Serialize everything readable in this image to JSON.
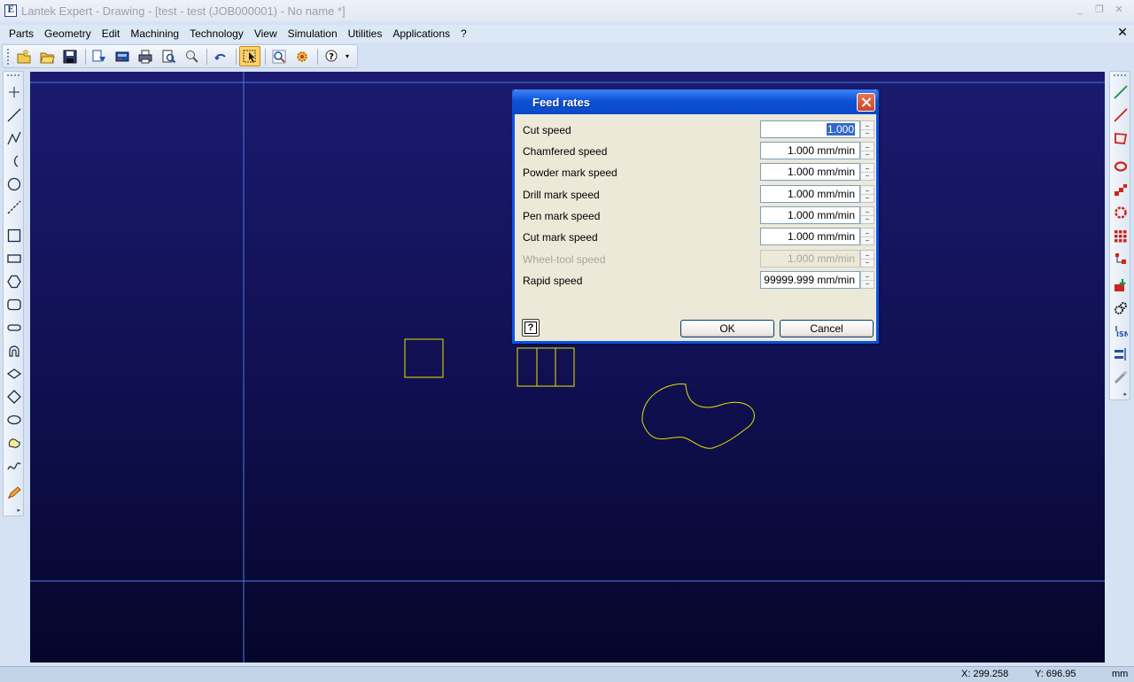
{
  "window": {
    "title": "Lantek Expert  - Drawing - [test - test (JOB000001) - No name *]",
    "icon_letter": "E",
    "minimize_glyph": "_",
    "restore_glyph": "❐",
    "close_glyph": "✕"
  },
  "menubar": {
    "items": [
      "Parts",
      "Geometry",
      "Edit",
      "Machining",
      "Technology",
      "View",
      "Simulation",
      "Utilities",
      "Applications",
      "?"
    ],
    "mdi_close_glyph": "✕"
  },
  "toolbar": {
    "icons": [
      "new-part-icon",
      "open-folder-icon",
      "save-icon",
      "export-icon",
      "machine-icon",
      "print-icon",
      "print-preview-icon",
      "zoom-preview-icon",
      "undo-arrow-icon",
      "select-tool-icon",
      "zoom-window-icon",
      "zoom-gear-icon",
      "help-context-icon"
    ],
    "more_glyph": "▾"
  },
  "left_tools": [
    "point-icon",
    "line-icon",
    "polyline-icon",
    "arc-icon",
    "circle-icon",
    "dashed-line-icon",
    "square-icon",
    "rectangle-icon",
    "hexagon-icon",
    "rounded-rect-icon",
    "slot-icon",
    "keyhole-icon",
    "rhombus-icon",
    "octagon-icon",
    "ellipse-icon",
    "freeform-icon",
    "spline-icon",
    "pencil-icon"
  ],
  "right_tools": [
    "line-green-icon",
    "line-red-icon",
    "polygon-red-icon",
    "ring-red-icon",
    "steps-red-icon",
    "gear-red-icon",
    "grid-red-icon",
    "tree-red-icon",
    "import-green-icon",
    "gears-icon",
    "isn-icon",
    "align-icon",
    "tool-icon"
  ],
  "panel_arrow_glyph": "▸",
  "colors": {
    "canvas_top": "#1b1a70",
    "canvas_bottom": "#06062a",
    "shape_stroke": "#e8e400",
    "guide_line": "#4a7bd8",
    "dialog_title": "#0a52e0"
  },
  "dialog": {
    "title": "Feed rates",
    "fields": [
      {
        "label": "Cut speed",
        "value": "1.000",
        "state": "selected"
      },
      {
        "label": "Chamfered speed",
        "value": "1.000 mm/min",
        "state": "normal"
      },
      {
        "label": "Powder mark speed",
        "value": "1.000 mm/min",
        "state": "normal"
      },
      {
        "label": "Drill mark speed",
        "value": "1.000 mm/min",
        "state": "normal"
      },
      {
        "label": "Pen mark speed",
        "value": "1.000 mm/min",
        "state": "normal"
      },
      {
        "label": "Cut mark speed",
        "value": "1.000 mm/min",
        "state": "normal"
      },
      {
        "label": "Wheel-tool speed",
        "value": "1.000 mm/min",
        "state": "disabled"
      },
      {
        "label": "Rapid speed",
        "value": "99999.999 mm/min",
        "state": "normal"
      }
    ],
    "help_glyph": "?",
    "ok_label": "OK",
    "cancel_label": "Cancel"
  },
  "status": {
    "x_label": "X: 299.258",
    "y_label": "Y: 696.95",
    "unit": "mm"
  }
}
